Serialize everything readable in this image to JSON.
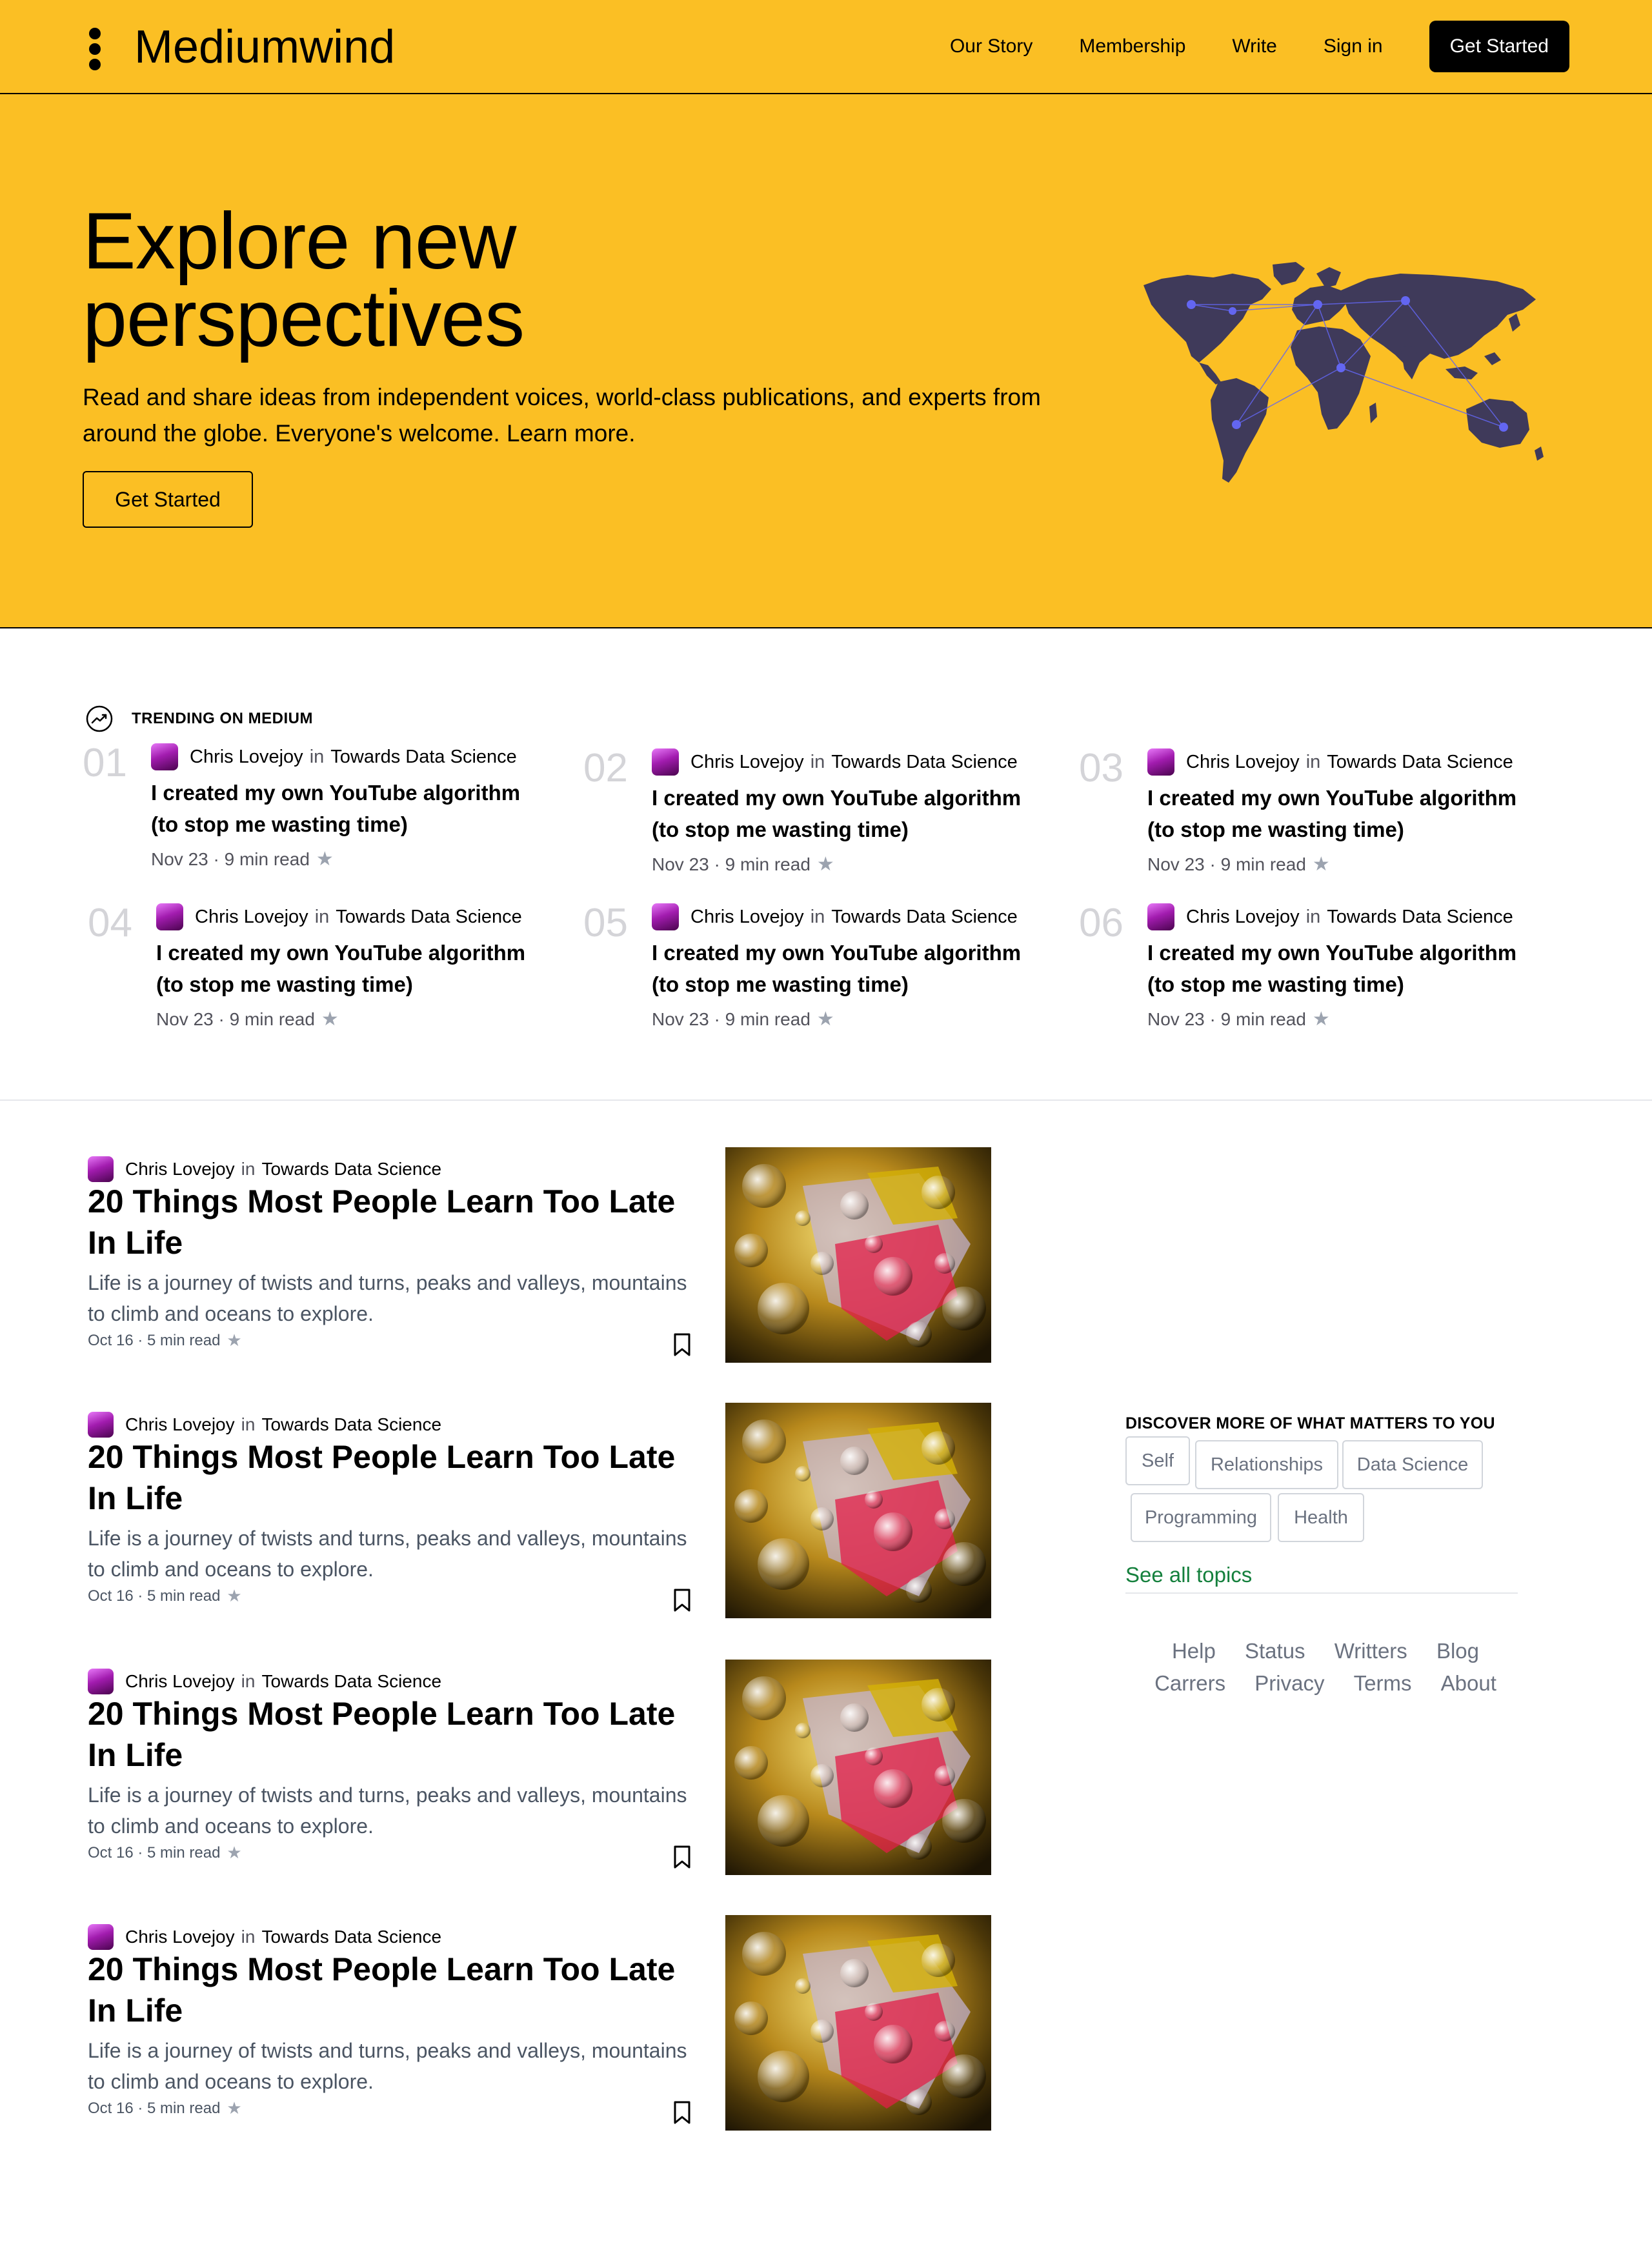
{
  "header": {
    "brand": "Mediumwind",
    "nav": [
      "Our Story",
      "Membership",
      "Write",
      "Sign in"
    ],
    "cta": "Get Started"
  },
  "hero": {
    "title_line1": "Explore new",
    "title_line2": "perspectives",
    "subtitle": "Read and share ideas from independent voices, world-class publications, and experts from around the globe. Everyone's welcome. Learn more.",
    "button": "Get Started"
  },
  "trending": {
    "label": "TRENDING ON MEDIUM",
    "items": [
      {
        "num": "01",
        "author": "Chris Lovejoy",
        "in": "in",
        "publication": "Towards Data Science",
        "title": "I created my own YouTube algorithm (to stop me wasting time)",
        "date": "Nov 23",
        "read": "9 min read"
      },
      {
        "num": "02",
        "author": "Chris Lovejoy",
        "in": "in",
        "publication": "Towards Data Science",
        "title": "I created my own YouTube algorithm (to stop me wasting time)",
        "date": "Nov 23",
        "read": "9 min read"
      },
      {
        "num": "03",
        "author": "Chris Lovejoy",
        "in": "in",
        "publication": "Towards Data Science",
        "title": "I created my own YouTube algorithm (to stop me wasting time)",
        "date": "Nov 23",
        "read": "9 min read"
      },
      {
        "num": "04",
        "author": "Chris Lovejoy",
        "in": "in",
        "publication": "Towards Data Science",
        "title": "I created my own YouTube algorithm (to stop me wasting time)",
        "date": "Nov 23",
        "read": "9 min read"
      },
      {
        "num": "05",
        "author": "Chris Lovejoy",
        "in": "in",
        "publication": "Towards Data Science",
        "title": "I created my own YouTube algorithm (to stop me wasting time)",
        "date": "Nov 23",
        "read": "9 min read"
      },
      {
        "num": "06",
        "author": "Chris Lovejoy",
        "in": "in",
        "publication": "Towards Data Science",
        "title": "I created my own YouTube algorithm (to stop me wasting time)",
        "date": "Nov 23",
        "read": "9 min read"
      }
    ]
  },
  "articles": [
    {
      "author": "Chris Lovejoy",
      "in": "in",
      "publication": "Towards Data Science",
      "title": "20 Things Most People Learn Too Late In Life",
      "subtitle": "Life is a journey of twists and turns, peaks and valleys, mountains to climb and oceans to explore.",
      "date": "Oct 16",
      "read": "5 min read"
    },
    {
      "author": "Chris Lovejoy",
      "in": "in",
      "publication": "Towards Data Science",
      "title": "20 Things Most People Learn Too Late In Life",
      "subtitle": "Life is a journey of twists and turns, peaks and valleys, mountains to climb and oceans to explore.",
      "date": "Oct 16",
      "read": "5 min read"
    },
    {
      "author": "Chris Lovejoy",
      "in": "in",
      "publication": "Towards Data Science",
      "title": "20 Things Most People Learn Too Late In Life",
      "subtitle": "Life is a journey of twists and turns, peaks and valleys, mountains to climb and oceans to explore.",
      "date": "Oct 16",
      "read": "5 min read"
    },
    {
      "author": "Chris Lovejoy",
      "in": "in",
      "publication": "Towards Data Science",
      "title": "20 Things Most People Learn Too Late In Life",
      "subtitle": "Life is a journey of twists and turns, peaks and valleys, mountains to climb and oceans to explore.",
      "date": "Oct 16",
      "read": "5 min read"
    }
  ],
  "sidebar": {
    "discover_label": "DISCOVER MORE OF WHAT MATTERS TO YOU",
    "topics": [
      "Self",
      "Relationships",
      "Data Science",
      "Programming",
      "Health"
    ],
    "see_all": "See all topics",
    "footer": [
      "Help",
      "Status",
      "Writters",
      "Blog",
      "Carrers",
      "Privacy",
      "Terms",
      "About"
    ]
  },
  "colors": {
    "brand_yellow": "#fbbf24",
    "link_green": "#15803d",
    "map_land": "#3f3a5a",
    "map_node": "#6366f1"
  },
  "icons": {
    "logo": "three-dots-icon",
    "trending": "trending-up-icon",
    "star": "star-icon",
    "bookmark": "bookmark-icon"
  }
}
